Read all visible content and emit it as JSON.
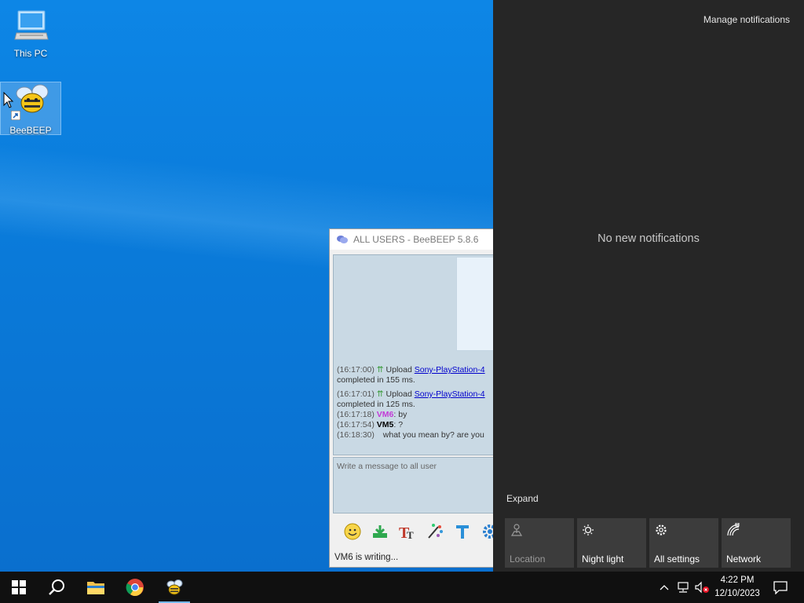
{
  "desktop": {
    "icons": [
      {
        "label": "This PC"
      },
      {
        "label": "BeeBEEP"
      }
    ]
  },
  "beebeep": {
    "title": "ALL USERS - BeeBEEP 5.8.6",
    "messages": {
      "m1_time": "(16:17:00)",
      "m1_text": "Upload",
      "m1_link": "Sony-PlayStation-4",
      "m1_cont": "completed in 155 ms.",
      "m2_time": "(16:17:01)",
      "m2_text": "Upload",
      "m2_link": "Sony-PlayStation-4",
      "m2_cont": "completed in 125 ms.",
      "m3_time": "(16:17:18)",
      "m3_user": "VM6",
      "m3_text": ": by",
      "m4_time": "(16:17:54)",
      "m4_user": "VM5",
      "m4_text": ": ?",
      "m5_time": "(16:18:30)",
      "m5_text": "what you mean by? are you"
    },
    "input_placeholder": "Write a message to all user",
    "status": "VM6 is writing..."
  },
  "action_center": {
    "manage_label": "Manage notifications",
    "empty_label": "No new notifications",
    "expand_label": "Expand",
    "tiles": [
      {
        "label": "Location",
        "icon": "location-icon",
        "enabled": false
      },
      {
        "label": "Night light",
        "icon": "night-light-icon",
        "enabled": true
      },
      {
        "label": "All settings",
        "icon": "gear-icon",
        "enabled": true
      },
      {
        "label": "Network",
        "icon": "network-icon",
        "enabled": true
      }
    ]
  },
  "taskbar": {
    "time": "4:22 PM",
    "date": "12/10/2023"
  },
  "colors": {
    "action_center_bg": "#262626",
    "tile_bg": "#3c3c3c",
    "taskbar_bg": "#101010",
    "vm6_color": "#c23bd6",
    "link_color": "#0000cc"
  }
}
